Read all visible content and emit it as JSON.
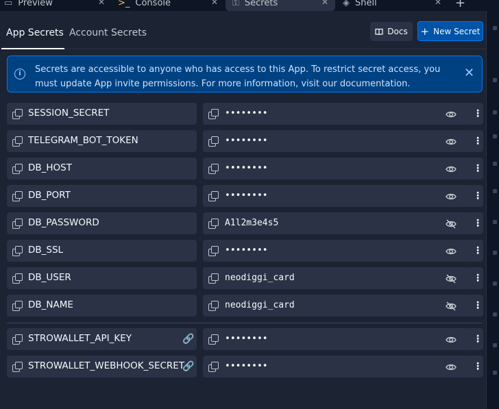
{
  "top_tabs": [
    {
      "label": "Preview",
      "icon": "monitor-icon"
    },
    {
      "label": "Console",
      "icon": "terminal-icon"
    },
    {
      "label": "Secrets",
      "icon": "lock-icon"
    },
    {
      "label": "Shell",
      "icon": "shell-icon"
    }
  ],
  "sub_tabs": {
    "app_secrets": "App Secrets",
    "account_secrets": "Account Secrets"
  },
  "toolbar": {
    "docs_label": "Docs",
    "new_secret_label": "New Secret"
  },
  "banner": {
    "text": "Secrets are accessible to anyone who has access to this App. To restrict secret access, you must update App invite permissions. For more information, visit our documentation."
  },
  "secrets": [
    {
      "key": "SESSION_SECRET",
      "value": "••••••••",
      "revealed": false,
      "linked": false
    },
    {
      "key": "TELEGRAM_BOT_TOKEN",
      "value": "••••••••",
      "revealed": false,
      "linked": false
    },
    {
      "key": "DB_HOST",
      "value": "••••••••",
      "revealed": false,
      "linked": false
    },
    {
      "key": "DB_PORT",
      "value": "••••••••",
      "revealed": false,
      "linked": false
    },
    {
      "key": "DB_PASSWORD",
      "value": "A1l2m3e4s5",
      "revealed": true,
      "linked": false
    },
    {
      "key": "DB_SSL",
      "value": "••••••••",
      "revealed": false,
      "linked": false
    },
    {
      "key": "DB_USER",
      "value": "neodiggi_card",
      "revealed": true,
      "linked": false
    },
    {
      "key": "DB_NAME",
      "value": "neodiggi_card",
      "revealed": true,
      "linked": false
    }
  ],
  "account_secrets": [
    {
      "key": "STROWALLET_API_KEY",
      "value": "••••••••",
      "revealed": false,
      "linked": true
    },
    {
      "key": "STROWALLET_WEBHOOK_SECRET",
      "value": "••••••••",
      "revealed": false,
      "linked": true
    }
  ],
  "colors": {
    "accent": "#0079f2",
    "panel": "#1c2333",
    "field": "#2b3245",
    "banner": "#004182"
  }
}
